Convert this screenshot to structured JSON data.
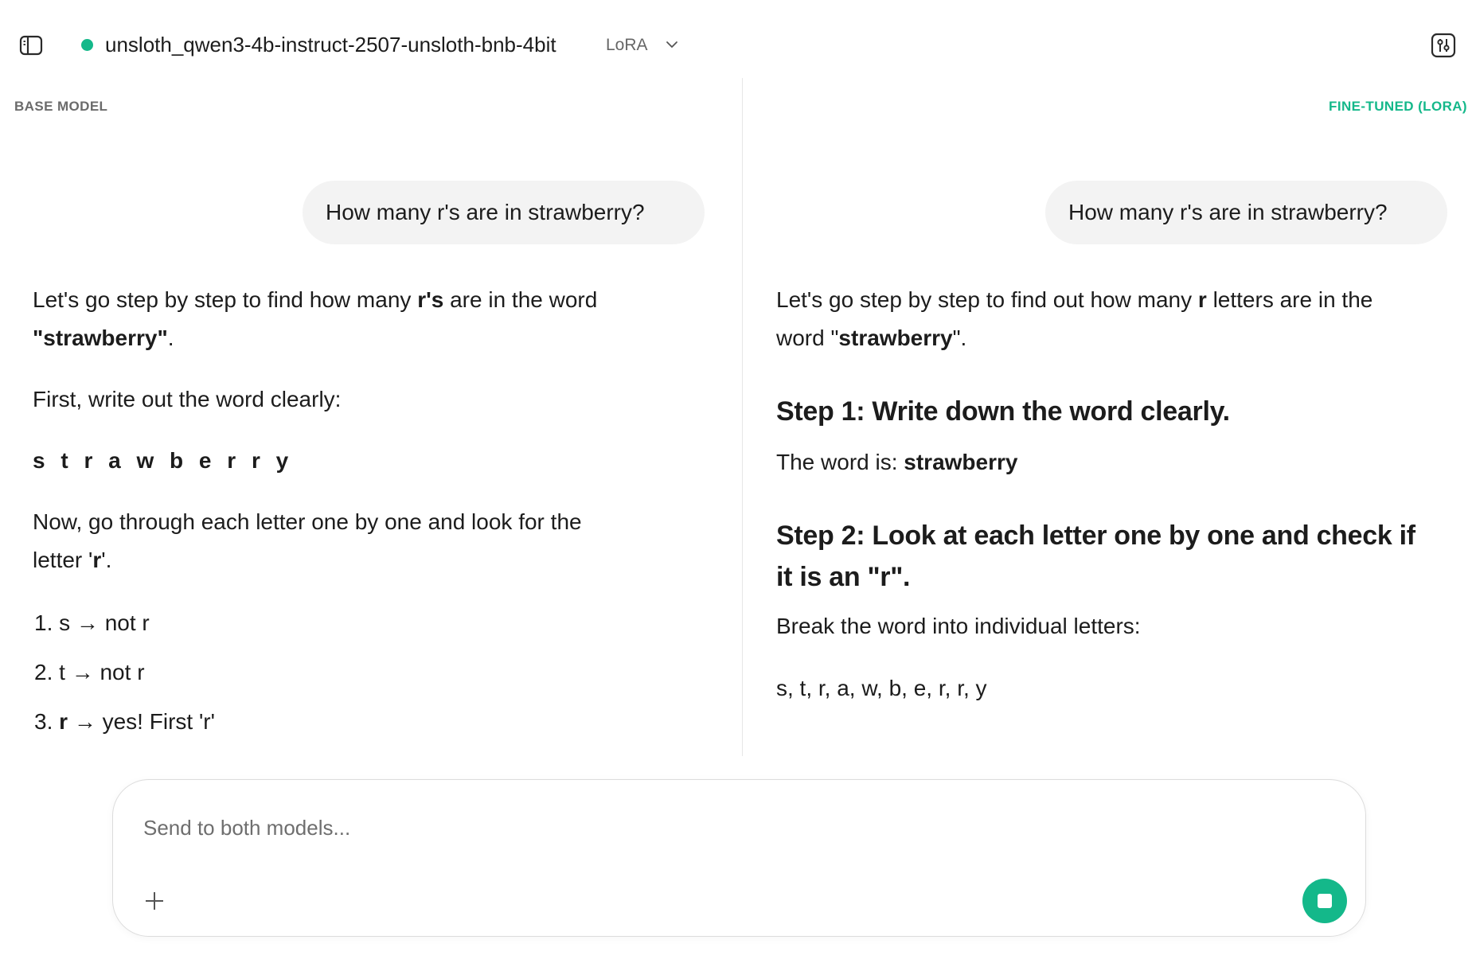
{
  "header": {
    "model_name": "unsloth_qwen3-4b-instruct-2507-unsloth-bnb-4bit",
    "model_badge": "LoRA",
    "status_color": "#14b88a"
  },
  "panels": {
    "base": {
      "label": "BASE MODEL",
      "user_message": "How many r's are in strawberry?",
      "response": {
        "p1_a": "Let's go step by step to find how many ",
        "p1_b": "r's",
        "p1_c": " are in the word",
        "p1_d": "\"strawberry\"",
        "p1_e": ".",
        "p2": "First, write out the word clearly:",
        "p3": "s t r a w b e r r y",
        "p4_a": "Now, go through each letter one by one and look for the",
        "p4_b": "letter '",
        "p4_c": "r",
        "p4_d": "'.",
        "list": [
          {
            "num": "1. ",
            "letter": "s",
            "arrow": " → ",
            "note": "not r"
          },
          {
            "num": "2. ",
            "letter": "t",
            "arrow": " → ",
            "note": "not r"
          },
          {
            "num": "3. ",
            "letter": "r",
            "arrow": " → ",
            "note": "yes! First 'r'"
          }
        ]
      }
    },
    "lora": {
      "label": "FINE-TUNED (LORA)",
      "user_message": "How many r's are in strawberry?",
      "response": {
        "p1_a": "Let's go step by step to find out how many ",
        "p1_b": "r",
        "p1_c": " letters are in the",
        "p1_d": "word \"",
        "p1_e": "strawberry",
        "p1_f": "\".",
        "h1": "Step 1: Write down the word clearly.",
        "p2_a": "The word is: ",
        "p2_b": "strawberry",
        "h2_line1": "Step 2: Look at each letter one by one and check if",
        "h2_line2": "it is an \"r\".",
        "p3": "Break the word into individual letters:",
        "p4": "s, t, r, a, w, b, e, r, r, y"
      }
    }
  },
  "composer": {
    "placeholder": "Send to both models...",
    "accent_color": "#14b88a"
  }
}
